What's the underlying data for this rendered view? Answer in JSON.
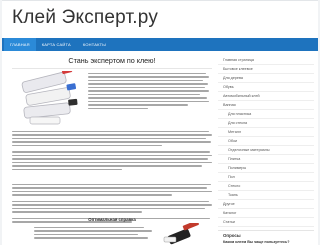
{
  "site": {
    "title": "Клей Эксперт.ру"
  },
  "nav": [
    {
      "label": "Главная",
      "active": true
    },
    {
      "label": "Карта сайта",
      "active": false
    },
    {
      "label": "Контакты",
      "active": false
    }
  ],
  "article": {
    "title": "Стань экспертом по клею!"
  },
  "ad": {
    "title": "Оптимальная справка"
  },
  "sidebar": {
    "menu": [
      {
        "label": "Главная страница"
      },
      {
        "label": "Бытовое клеевое"
      },
      {
        "label": "Для дерева"
      },
      {
        "label": "Обувь"
      },
      {
        "label": "Автомобильный клей"
      },
      {
        "label": "Ванная"
      },
      {
        "label": "Для пластика"
      },
      {
        "label": "Для стекла"
      },
      {
        "label": "Металл"
      },
      {
        "label": "Обои"
      },
      {
        "label": "Отделочные материалы"
      },
      {
        "label": "Плитка"
      },
      {
        "label": "Полимеры"
      },
      {
        "label": "Пол"
      },
      {
        "label": "Стекло"
      },
      {
        "label": "Ткань"
      },
      {
        "label": "Другое"
      }
    ],
    "extra": [
      {
        "label": "Каталог"
      },
      {
        "label": "Статьи"
      }
    ],
    "poll": {
      "title": "Опросы",
      "question": "Каким клеем Вы чаще пользуетесь?",
      "options": [
        "ПВА",
        "Момент",
        "Суперклей",
        "Другой"
      ]
    }
  },
  "colors": {
    "brand": "#1e73be",
    "nav_active": "#2b8ad8"
  }
}
